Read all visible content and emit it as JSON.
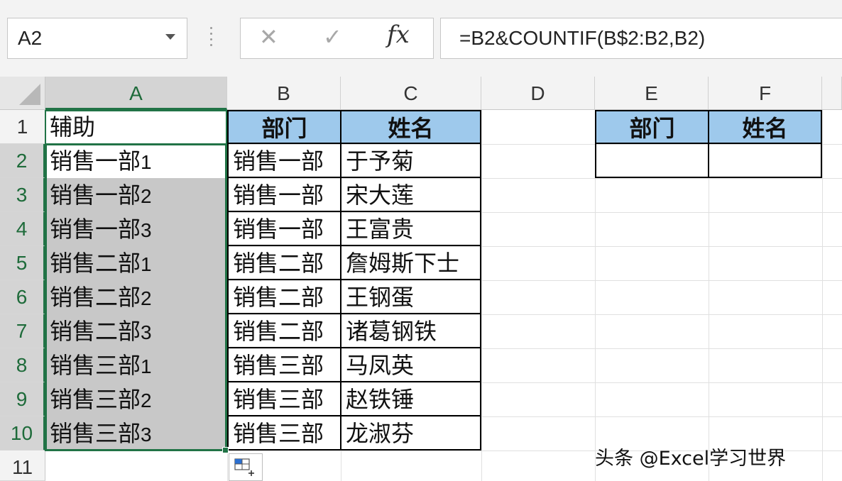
{
  "formula_bar": {
    "name_box": "A2",
    "cancel_glyph": "✕",
    "enter_glyph": "✓",
    "fx_label": "fx",
    "formula": "=B2&COUNTIF(B$2:B2,B2)"
  },
  "columns": [
    "A",
    "B",
    "C",
    "D",
    "E",
    "F"
  ],
  "rows": [
    "1",
    "2",
    "3",
    "4",
    "5",
    "6",
    "7",
    "8",
    "9",
    "10",
    "11"
  ],
  "cells": {
    "A1": "辅助",
    "B1": "部门",
    "C1": "姓名",
    "E1": "部门",
    "F1": "姓名",
    "helper": [
      {
        "dept": "销售一部",
        "n": "1"
      },
      {
        "dept": "销售一部",
        "n": "2"
      },
      {
        "dept": "销售一部",
        "n": "3"
      },
      {
        "dept": "销售二部",
        "n": "1"
      },
      {
        "dept": "销售二部",
        "n": "2"
      },
      {
        "dept": "销售二部",
        "n": "3"
      },
      {
        "dept": "销售三部",
        "n": "1"
      },
      {
        "dept": "销售三部",
        "n": "2"
      },
      {
        "dept": "销售三部",
        "n": "3"
      }
    ],
    "dept": [
      "销售一部",
      "销售一部",
      "销售一部",
      "销售二部",
      "销售二部",
      "销售二部",
      "销售三部",
      "销售三部",
      "销售三部"
    ],
    "name": [
      "于予菊",
      "宋大莲",
      "王富贵",
      "詹姆斯下士",
      "王钢蛋",
      "诸葛钢铁",
      "马凤英",
      "赵铁锤",
      "龙淑芬"
    ]
  },
  "colors": {
    "accent": "#217346",
    "header_fill": "#9ec9ec",
    "selection_fill": "#c8c8c8"
  },
  "watermark": "头条 @Excel学习世界",
  "icons": {
    "quick_analysis": "quick-analysis-icon"
  }
}
